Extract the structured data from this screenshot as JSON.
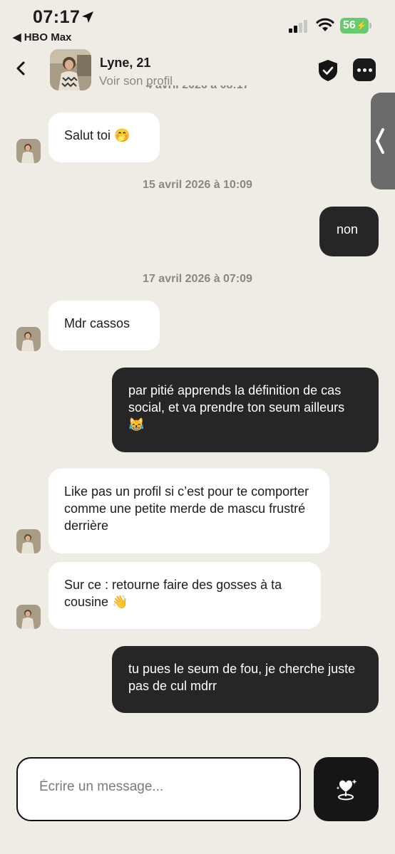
{
  "status_bar": {
    "time": "07:17",
    "back_app": "◀ HBO Max",
    "battery": "56"
  },
  "header": {
    "name": "Lyne, 21",
    "subtitle": "Voir son profil",
    "cut_date": "4 avril 2026 à 08:17"
  },
  "messages": {
    "m1": "Salut toi 🤭",
    "d1": "15 avril 2026 à 10:09",
    "m2": "non",
    "d2": "17 avril 2026 à 07:09",
    "m3": "Mdr cassos",
    "m4": "par pitié apprends la définition de cas social, et va prendre ton seum ailleurs 😹",
    "m5": "Like pas un profil si c’est pour te comporter comme une petite merde de mascu frustré derrière",
    "m6": "Sur ce : retourne faire des gosses à ta cousine 👋",
    "m7": "tu pues le seum de fou, je cherche juste pas de cul mdrr"
  },
  "composer": {
    "placeholder": "Écrire un message..."
  },
  "colors": {
    "background": "#efece5",
    "sent_bubble": "#262626",
    "received_bubble": "#ffffff",
    "battery": "#69c96e"
  },
  "icons": [
    "location-arrow-icon",
    "signal-icon",
    "wifi-icon",
    "battery-icon",
    "back-chevron-icon",
    "shield-check-icon",
    "more-dots-icon",
    "side-chevron-icon",
    "heart-sparkle-icon"
  ]
}
